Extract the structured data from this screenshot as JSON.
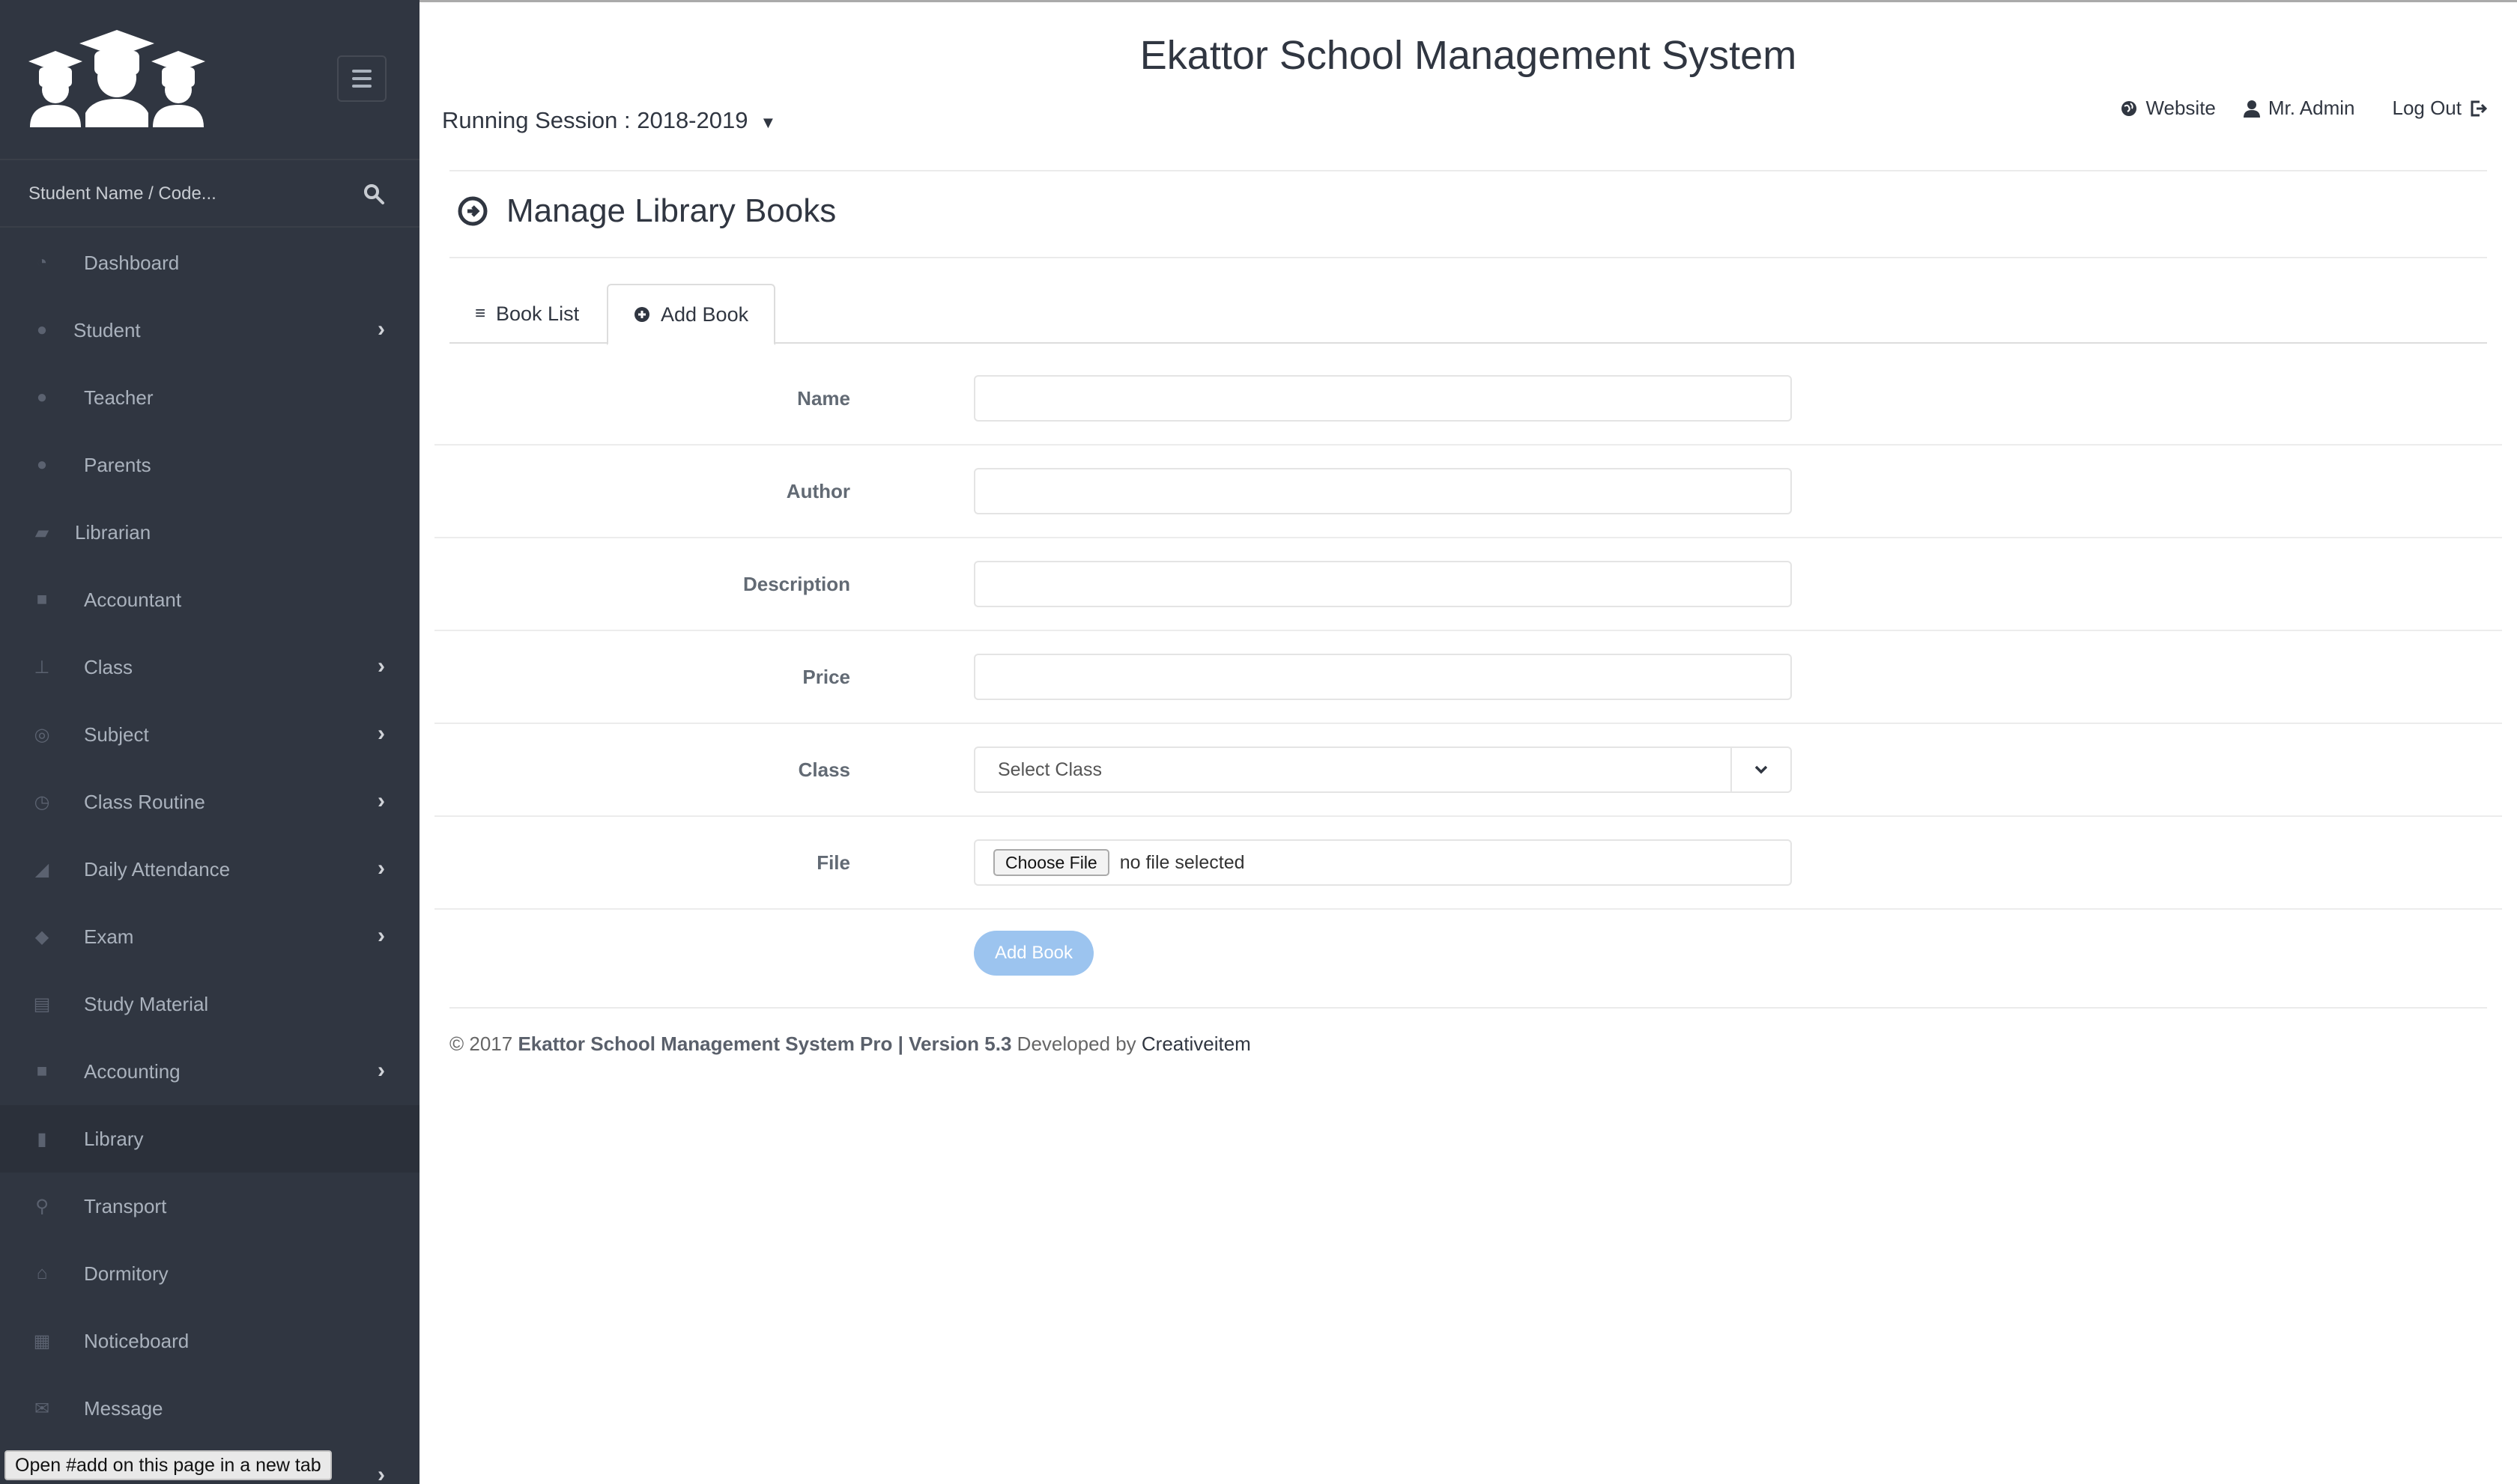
{
  "app_title": "Ekattor School Management System",
  "session": {
    "label": "Running Session : 2018-2019"
  },
  "header_links": {
    "website": "Website",
    "user": "Mr. Admin",
    "logout": "Log Out"
  },
  "search": {
    "placeholder": "Student Name / Code..."
  },
  "sidebar": {
    "items": [
      {
        "label": "Dashboard",
        "icon": "gauge-icon"
      },
      {
        "label": "Student",
        "icon": "users-icon",
        "has_children": true
      },
      {
        "label": "Teacher",
        "icon": "teacher-icon"
      },
      {
        "label": "Parents",
        "icon": "user-icon"
      },
      {
        "label": "Librarian",
        "icon": "book-icon"
      },
      {
        "label": "Accountant",
        "icon": "briefcase-icon"
      },
      {
        "label": "Class",
        "icon": "sitemap-icon",
        "has_children": true
      },
      {
        "label": "Subject",
        "icon": "subject-icon",
        "has_children": true
      },
      {
        "label": "Class Routine",
        "icon": "clock-icon",
        "has_children": true
      },
      {
        "label": "Daily Attendance",
        "icon": "chart-icon",
        "has_children": true
      },
      {
        "label": "Exam",
        "icon": "graduation-icon",
        "has_children": true
      },
      {
        "label": "Study Material",
        "icon": "open-book-icon"
      },
      {
        "label": "Accounting",
        "icon": "suitcase-icon",
        "has_children": true
      },
      {
        "label": "Library",
        "icon": "library-book-icon",
        "active": true
      },
      {
        "label": "Transport",
        "icon": "location-icon"
      },
      {
        "label": "Dormitory",
        "icon": "home-icon"
      },
      {
        "label": "Noticeboard",
        "icon": "notice-icon"
      },
      {
        "label": "Message",
        "icon": "mail-icon"
      }
    ]
  },
  "page_title": "Manage Library Books",
  "tabs": [
    {
      "label": "Book List",
      "icon": "list-icon"
    },
    {
      "label": "Add Book",
      "icon": "plus-circle-icon",
      "active": true
    }
  ],
  "form": {
    "name_label": "Name",
    "author_label": "Author",
    "description_label": "Description",
    "price_label": "Price",
    "class_label": "Class",
    "class_value": "Select Class",
    "file_label": "File",
    "file_button": "Choose File",
    "file_status": "no file selected",
    "submit_label": "Add Book"
  },
  "footer": {
    "prefix": "© 2017",
    "product": "Ekattor School Management System Pro",
    "sep": "|",
    "version": "Version 5.3",
    "dev_text": "Developed by",
    "developer": "Creativeitem"
  },
  "status_bar": "Open #add on this page in a new tab",
  "colors": {
    "sidebar_bg": "#303641",
    "accent_button": "#9cc4ef",
    "text": "#303641"
  }
}
